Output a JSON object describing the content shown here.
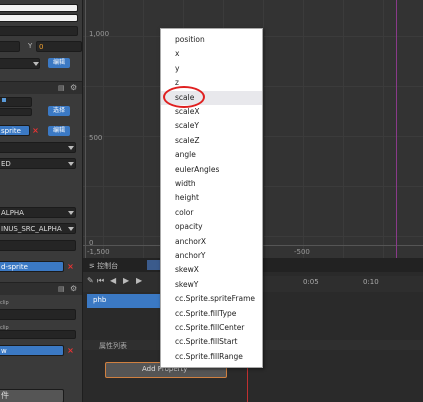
{
  "inspector": {
    "y_label": "Y",
    "y_value": "0",
    "select_btn_1": "编辑",
    "select_btn_2": "选择",
    "sprite_field": "sprite",
    "edit_btn": "编辑",
    "enum_1": "ED",
    "enum_2": "ALPHA",
    "enum_3": "INUS_SRC_ALPHA",
    "sprite_field_2": "d-sprite",
    "clip_label_1": "clip",
    "clip_label_2": "clip",
    "bottom_field": "w",
    "bottom_button": "件"
  },
  "scene": {
    "label_1000": "1,000",
    "label_500": "500",
    "label_neg500_x": "-500",
    "label_neg1500": "-1,500",
    "label_0": "0"
  },
  "timeline": {
    "console_tab": "控制台",
    "node_item": "phb",
    "time_1": "0:05",
    "time_2": "0:10",
    "property_list_label": "属性列表",
    "add_property_button": "Add Property"
  },
  "menu": {
    "items": [
      "position",
      "x",
      "y",
      "z",
      "scale",
      "scaleX",
      "scaleY",
      "scaleZ",
      "angle",
      "eulerAngles",
      "width",
      "height",
      "color",
      "opacity",
      "anchorX",
      "anchorY",
      "skewX",
      "skewY",
      "cc.Sprite.spriteFrame",
      "cc.Sprite.fillType",
      "cc.Sprite.fillCenter",
      "cc.Sprite.fillStart",
      "cc.Sprite.fillRange"
    ],
    "highlighted_index": 4,
    "annotation_color": "#e02020"
  }
}
